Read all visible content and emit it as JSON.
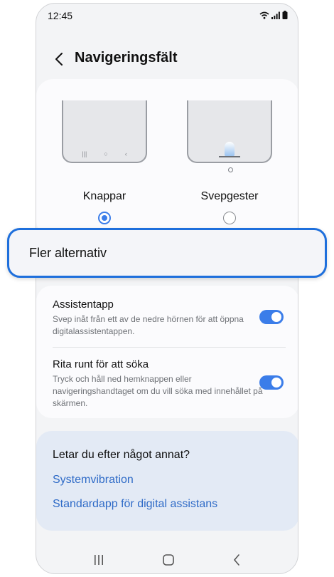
{
  "status": {
    "time": "12:45"
  },
  "header": {
    "title": "Navigeringsfält"
  },
  "nav_type": {
    "options": [
      {
        "label": "Knappar",
        "selected": true
      },
      {
        "label": "Svepgester",
        "selected": false
      }
    ]
  },
  "more_options": {
    "label": "Fler alternativ"
  },
  "settings": [
    {
      "title": "Assistentapp",
      "description": "Svep inåt från ett av de nedre hörnen för att öppna digitalassistentappen.",
      "enabled": true
    },
    {
      "title": "Rita runt för att söka",
      "description": "Tryck och håll ned hemknappen eller navigeringshandtaget om du vill söka med innehållet på skärmen.",
      "enabled": true
    }
  ],
  "suggestions": {
    "title": "Letar du efter något annat?",
    "links": [
      "Systemvibration",
      "Standardapp för digital assistans"
    ]
  },
  "colors": {
    "accent": "#3b7de9",
    "highlight_border": "#1e6fdc",
    "link": "#2f6bc7"
  }
}
